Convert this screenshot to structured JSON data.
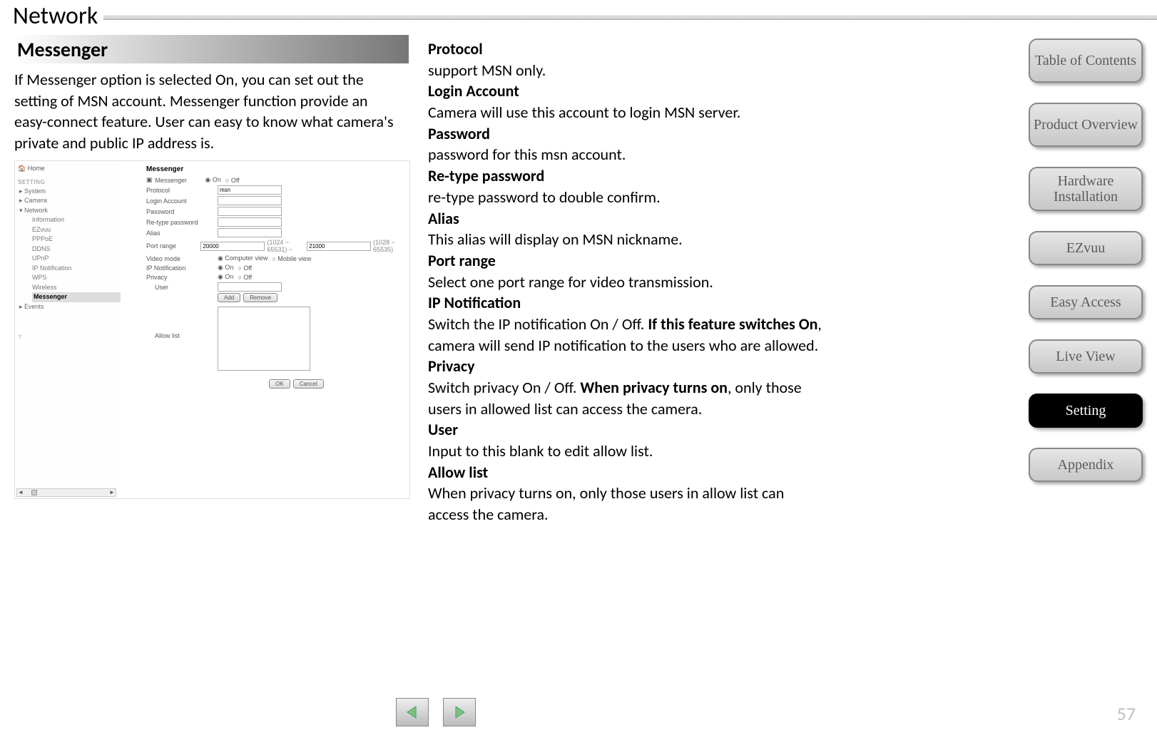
{
  "page": {
    "title": "Network",
    "number": "57"
  },
  "section": {
    "header": "Messenger",
    "intro": "If Messenger option is selected On, you can set out the setting of MSN account. Messenger function provide an easy-connect feature. User can easy to know what camera's private and public IP address is."
  },
  "embed": {
    "home": "Home",
    "settingLabel": "SETTING",
    "tree": {
      "system": "System",
      "camera": "Camera",
      "network": "Network",
      "sub": [
        "Information",
        "EZvuu",
        "PPPoE",
        "DDNS",
        "UPnP",
        "IP Notification",
        "WPS",
        "Wireless",
        "Messenger"
      ],
      "events": "Events"
    },
    "form": {
      "title": "Messenger",
      "toggleLabel": "Messenger",
      "on": "On",
      "off": "Off",
      "protocol": "Protocol",
      "protocolValue": "msn",
      "login": "Login Account",
      "password": "Password",
      "retype": "Re-type password",
      "alias": "Alias",
      "portRange": "Port range",
      "portStart": "20000",
      "portStartHint": "(1024 ~ 65531)  ~",
      "portEnd": "21000",
      "portEndHint": "(1028 ~ 65535)",
      "videoMode": "Video mode",
      "videoComputer": "Computer view",
      "videoMobile": "Mobile view",
      "ipNotif": "IP Notification",
      "privacy": "Privacy",
      "user": "User",
      "add": "Add",
      "remove": "Remove",
      "allow": "Allow list",
      "ok": "OK",
      "cancel": "Cancel"
    }
  },
  "desc": {
    "protocol_h": "Protocol",
    "protocol_b": "support MSN only.",
    "login_h": "Login Account",
    "login_b": "Camera will use this account to login MSN server.",
    "password_h": "Password",
    "password_b": "password for this msn account.",
    "retype_h": "Re-type password",
    "retype_b": "re-type password to double confirm.",
    "alias_h": "Alias",
    "alias_b": "This alias will display on MSN nickname.",
    "port_h": "Port range",
    "port_b": "Select one port range for video transmission.",
    "ipn_h": "IP Notification",
    "ipn_b1": "Switch the IP notification On / Off. ",
    "ipn_bold": "If this feature switches On",
    "ipn_b2": ", camera will send IP notification to the users who are allowed.",
    "priv_h": "Privacy",
    "priv_b1": "Switch privacy On / Off. ",
    "priv_bold": "When privacy turns on",
    "priv_b2": ", only those users in allowed list can access the camera.",
    "user_h": "User",
    "user_b": "Input to this blank to edit allow list.",
    "allow_h": "Allow list",
    "allow_b": "When privacy turns on, only those users in allow list can access the camera."
  },
  "nav": {
    "toc": "Table of Contents",
    "product": "Product Overview",
    "hardware": "Hardware Installation",
    "ezvuu": "EZvuu",
    "easy": "Easy Access",
    "live": "Live View",
    "setting": "Setting",
    "appendix": "Appendix"
  }
}
